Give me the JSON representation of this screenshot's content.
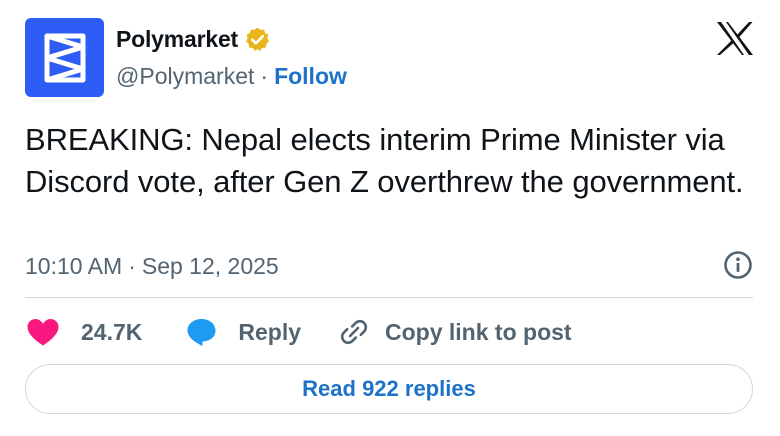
{
  "author": {
    "display_name": "Polymarket",
    "handle": "@Polymarket",
    "separator": "·",
    "follow_label": "Follow",
    "verified_badge_color": "#e8b51c",
    "avatar_color": "#2d5df5"
  },
  "tweet": {
    "text": "BREAKING: Nepal elects interim Prime Minister via Discord vote, after Gen Z overthrew the government.",
    "time": "10:10 AM",
    "separator": "·",
    "date": "Sep 12, 2025"
  },
  "actions": {
    "like_count": "24.7K",
    "reply_label": "Reply",
    "copy_label": "Copy link to post"
  },
  "footer": {
    "read_replies_label": "Read 922 replies"
  },
  "colors": {
    "link_blue": "#1d72c9",
    "like_pink": "#f91880",
    "reply_blue": "#1d9bf0",
    "text_primary": "#0f1419",
    "text_secondary": "#536471"
  },
  "icons": {
    "avatar": "polymarket-logo-icon",
    "badge": "verified-badge-icon",
    "brand": "x-logo-icon",
    "info": "info-icon",
    "like": "heart-icon",
    "reply": "speech-bubble-icon",
    "copy": "link-icon"
  }
}
